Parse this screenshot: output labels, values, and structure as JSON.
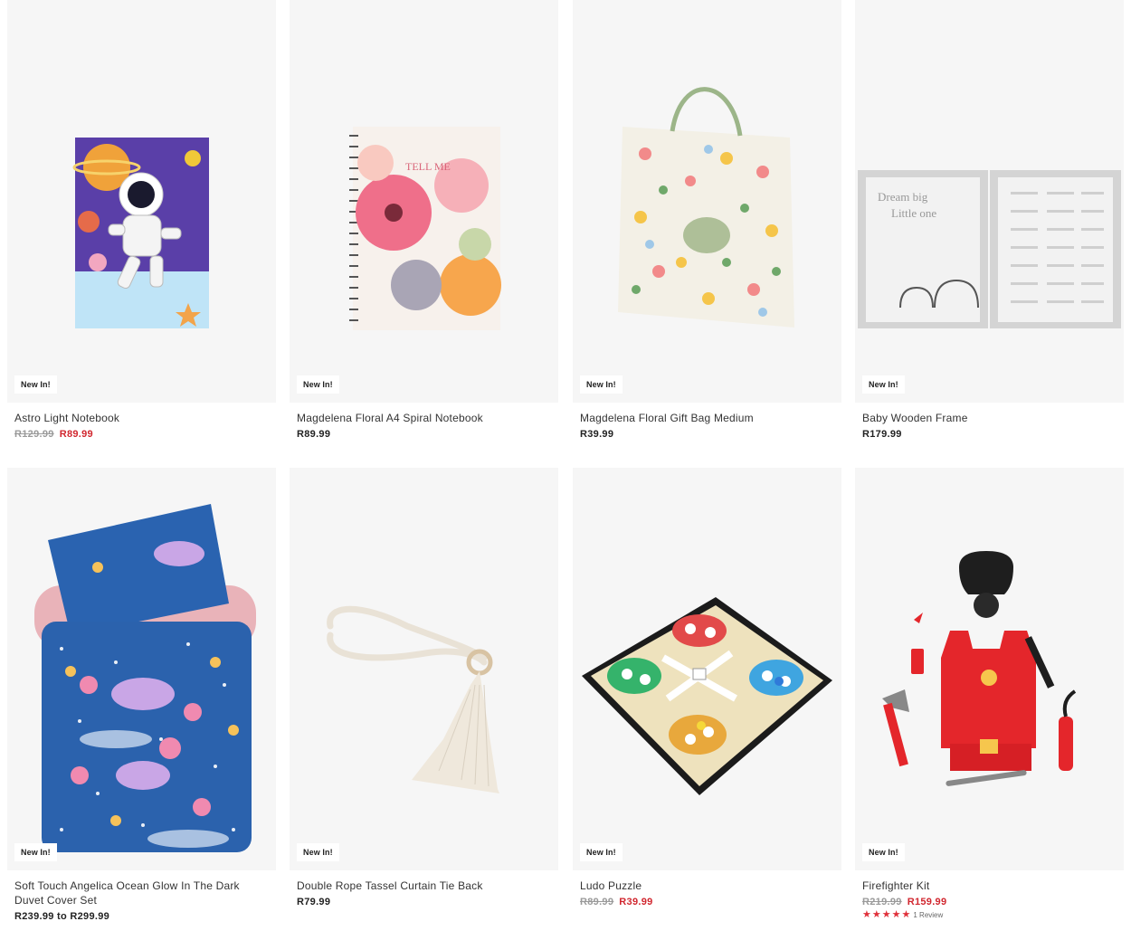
{
  "badge_label": "New In!",
  "products": [
    {
      "title": "Astro Light Notebook",
      "was": "R129.99",
      "now": "R89.99",
      "image_icon": "astronaut-notebook-icon"
    },
    {
      "title": "Magdelena Floral A4 Spiral Notebook",
      "price": "R89.99",
      "image_icon": "floral-notebook-icon"
    },
    {
      "title": "Magdelena Floral Gift Bag Medium",
      "price": "R39.99",
      "image_icon": "floral-gift-bag-icon"
    },
    {
      "title": "Baby Wooden Frame",
      "price": "R179.99",
      "image_icon": "baby-frame-icon"
    },
    {
      "title": "Soft Touch Angelica Ocean Glow In The Dark Duvet Cover Set",
      "price": "R239.99 to R299.99",
      "image_icon": "duvet-set-icon"
    },
    {
      "title": "Double Rope Tassel Curtain Tie Back",
      "price": "R79.99",
      "image_icon": "rope-tassel-icon"
    },
    {
      "title": "Ludo Puzzle",
      "was": "R89.99",
      "now": "R39.99",
      "image_icon": "ludo-board-icon"
    },
    {
      "title": "Firefighter Kit",
      "was": "R219.99",
      "now": "R159.99",
      "image_icon": "firefighter-kit-icon",
      "rating": 5,
      "reviews": "1 Review"
    }
  ],
  "colors": {
    "sale": "#d1272f",
    "strike": "#9a9a9a",
    "image_bg": "#f6f6f6",
    "star": "#e0303a"
  },
  "rating_icon": "star-icon"
}
